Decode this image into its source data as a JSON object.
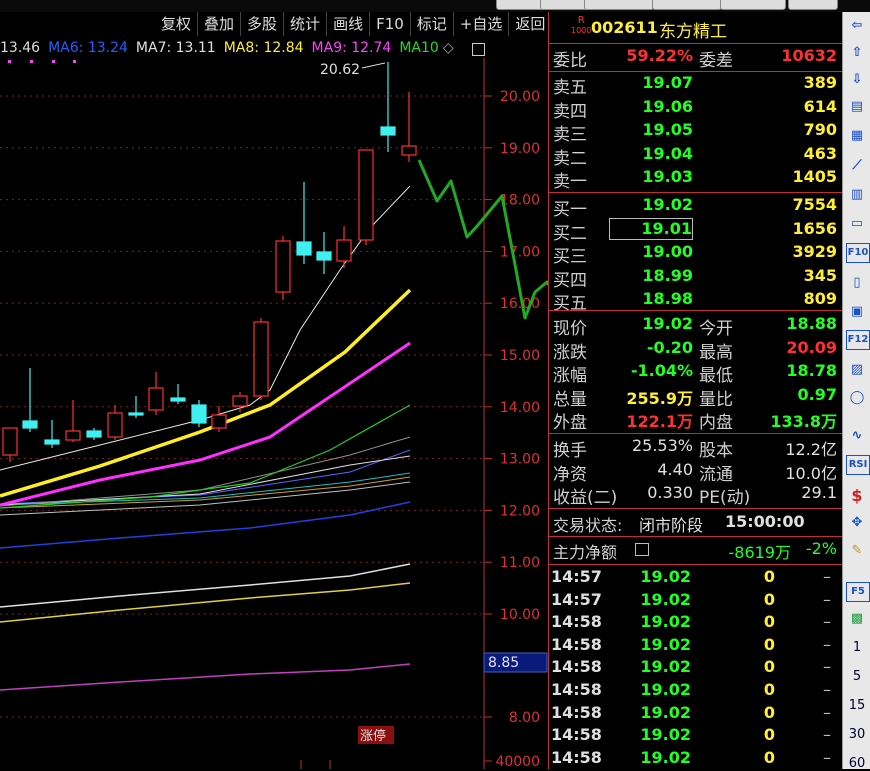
{
  "toolbar": {
    "buttons": [
      "复权",
      "叠加",
      "多股",
      "统计",
      "画线",
      "F10",
      "标记",
      "+自选",
      "返回"
    ]
  },
  "ma_legend": [
    {
      "label": "13.46",
      "color": "#dddddd"
    },
    {
      "label": "MA6: 13.24",
      "color": "#2060ff"
    },
    {
      "label": "MA7: 13.11",
      "color": "#e0e0e0"
    },
    {
      "label": "MA8: 12.84",
      "color": "#ffee33"
    },
    {
      "label": "MA9: 12.74",
      "color": "#ff40ff"
    },
    {
      "label": "MA10",
      "color": "#22dd22"
    }
  ],
  "chart": {
    "axis_labels": [
      "20.00",
      "19.00",
      "18.00",
      "17.00",
      "16.00",
      "15.00",
      "14.00",
      "13.00",
      "12.00",
      "11.00",
      "10.00",
      "8.00",
      "40000"
    ],
    "high_annotation": "20.62",
    "price_box": "8.85",
    "limit_tag": "涨停"
  },
  "stock": {
    "code": "002611",
    "name": "东方精工",
    "badge_top": "R",
    "badge_bottom": "1000"
  },
  "quote": {
    "weibi_label": "委比",
    "weibi": "59.22%",
    "weicha_label": "委差",
    "weicha": "10632",
    "asks": [
      {
        "label": "卖五",
        "price": "19.07",
        "vol": "389"
      },
      {
        "label": "卖四",
        "price": "19.06",
        "vol": "614"
      },
      {
        "label": "卖三",
        "price": "19.05",
        "vol": "790"
      },
      {
        "label": "卖二",
        "price": "19.04",
        "vol": "463"
      },
      {
        "label": "卖一",
        "price": "19.03",
        "vol": "1405"
      }
    ],
    "bids": [
      {
        "label": "买一",
        "price": "19.02",
        "vol": "7554"
      },
      {
        "label": "买二",
        "price": "19.01",
        "vol": "1656"
      },
      {
        "label": "买三",
        "price": "19.00",
        "vol": "3929"
      },
      {
        "label": "买四",
        "price": "18.99",
        "vol": "345"
      },
      {
        "label": "买五",
        "price": "18.98",
        "vol": "809"
      }
    ],
    "stats": [
      {
        "l1": "现价",
        "v1": "19.02",
        "c1": "#22ff22",
        "l2": "今开",
        "v2": "18.88",
        "c2": "#22ff22"
      },
      {
        "l1": "涨跌",
        "v1": "-0.20",
        "c1": "#22ff22",
        "l2": "最高",
        "v2": "20.09",
        "c2": "#ff3030"
      },
      {
        "l1": "涨幅",
        "v1": "-1.04%",
        "c1": "#22ff22",
        "l2": "最低",
        "v2": "18.78",
        "c2": "#22ff22"
      },
      {
        "l1": "总量",
        "v1": "255.9万",
        "c1": "#ffee33",
        "l2": "量比",
        "v2": "0.97",
        "c2": "#22ff22"
      },
      {
        "l1": "外盘",
        "v1": "122.1万",
        "c1": "#ff3030",
        "l2": "内盘",
        "v2": "133.8万",
        "c2": "#22ff22"
      }
    ],
    "stats2": [
      {
        "l1": "换手",
        "v1": "25.53%",
        "l2": "股本",
        "v2": "12.2亿"
      },
      {
        "l1": "净资",
        "v1": "4.40",
        "l2": "流通",
        "v2": "10.0亿"
      },
      {
        "l1": "收益(二)",
        "v1": "0.330",
        "l2": "PE(动)",
        "v2": "29.1"
      }
    ],
    "status_label": "交易状态:",
    "status": "闭市阶段",
    "status_time": "15:00:00",
    "flow_label": "主力净额",
    "flow_value": "-8619万",
    "flow_pct": "-2%",
    "ticks": [
      {
        "t": "14:57",
        "p": "19.02",
        "v": "0",
        "d": "–"
      },
      {
        "t": "14:57",
        "p": "19.02",
        "v": "0",
        "d": "–"
      },
      {
        "t": "14:58",
        "p": "19.02",
        "v": "0",
        "d": "–"
      },
      {
        "t": "14:58",
        "p": "19.02",
        "v": "0",
        "d": "–"
      },
      {
        "t": "14:58",
        "p": "19.02",
        "v": "0",
        "d": "–"
      },
      {
        "t": "14:58",
        "p": "19.02",
        "v": "0",
        "d": "–"
      },
      {
        "t": "14:58",
        "p": "19.02",
        "v": "0",
        "d": "–"
      },
      {
        "t": "14:58",
        "p": "19.02",
        "v": "0",
        "d": "–"
      },
      {
        "t": "14:58",
        "p": "19.02",
        "v": "0",
        "d": "–"
      }
    ]
  },
  "right_bar": {
    "icons": [
      "arrow-left-icon",
      "arrow-up-icon",
      "arrow-down-icon",
      "notes-icon",
      "grid-icon",
      "line-chart-icon",
      "candle-icon",
      "window-icon",
      "f10-icon",
      "book-icon",
      "self-select-icon",
      "f12-icon",
      "f10b-icon",
      "refresh-icon",
      "wave-icon",
      "rsi-icon",
      "dollar-icon",
      "move-icon",
      "pen-icon",
      "f5-icon",
      "green-box-icon"
    ],
    "labels": {
      "rsi": "RSI",
      "f10": "F10",
      "f12": "F12",
      "f5": "F5"
    },
    "numbers": [
      "1",
      "5",
      "15",
      "30",
      "60"
    ]
  },
  "colors": {
    "up": "#ff3030",
    "down": "#22ff22",
    "yellow": "#ffee33",
    "cyan": "#40f0f0",
    "border": "#c03030"
  }
}
